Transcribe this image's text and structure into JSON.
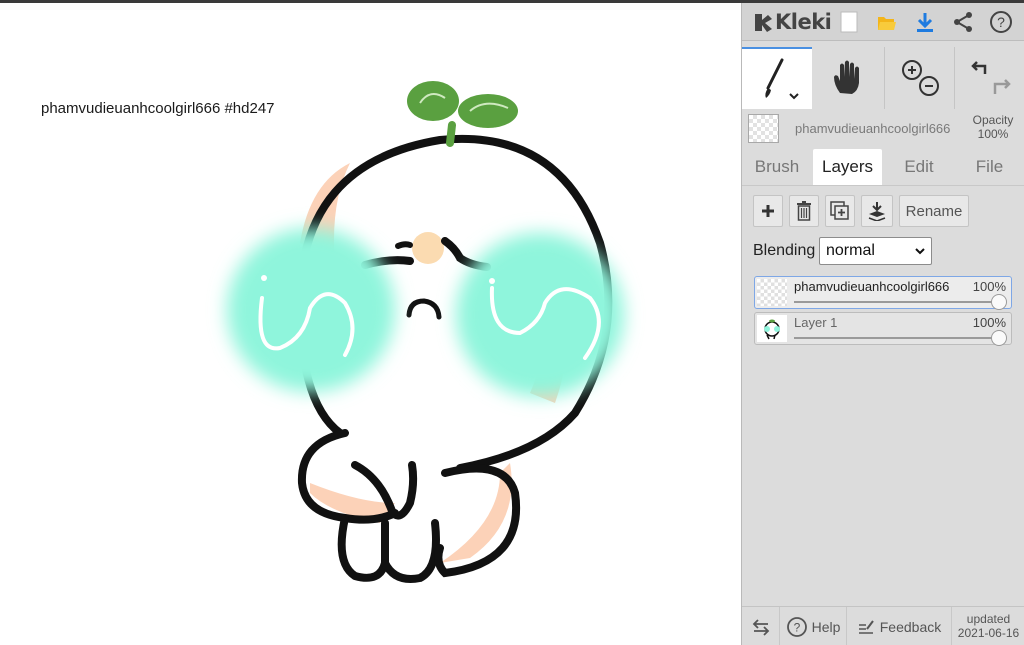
{
  "canvas": {
    "overlay_text": "phamvudieuanhcoolgirl666 #hd247"
  },
  "header": {
    "logo_text": "Kleki",
    "icons": [
      "new-image-icon",
      "open-folder-icon",
      "download-icon",
      "share-icon",
      "help-icon"
    ]
  },
  "tools": {
    "items": [
      "brush-tool-icon",
      "hand-tool-icon",
      "zoom-icon",
      "undo-redo-icon"
    ]
  },
  "brush": {
    "name": "phamvudieuanhcoolgirl666",
    "opacity_label": "Opacity",
    "opacity_value": "100%"
  },
  "tabs": [
    "Brush",
    "Layers",
    "Edit",
    "File"
  ],
  "active_tab": "Layers",
  "layer_tools": {
    "rename_label": "Rename"
  },
  "blending": {
    "label": "Blending",
    "value": "normal"
  },
  "layers": [
    {
      "name": "phamvudieuanhcoolgirl666",
      "opacity": "100%",
      "active": true
    },
    {
      "name": "Layer 1",
      "opacity": "100%",
      "active": false
    }
  ],
  "footer": {
    "help_label": "Help",
    "feedback_label": "Feedback",
    "updated_label": "updated",
    "updated_date": "2021-06-16"
  },
  "colors": {
    "accent": "#4a90e2",
    "panel_bg": "#dcdcdc",
    "blush": "#8ff5dc",
    "sprout": "#5aa040",
    "cheek_shade": "#fcd2b8"
  }
}
